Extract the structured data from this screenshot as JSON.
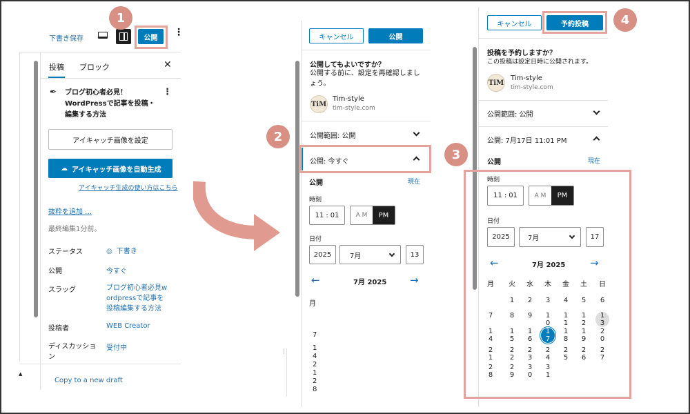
{
  "colors": {
    "accent": "#007cba",
    "badge": "#d88f84",
    "highlight": "#e3a59b",
    "arrow": "#e09a8f"
  },
  "step_badges": [
    "1",
    "2",
    "3",
    "4"
  ],
  "panel1": {
    "save_draft": "下書き保存",
    "publish": "公開",
    "tabs": {
      "post": "投稿",
      "block": "ブロック"
    },
    "post_title": "ブログ初心者必見！WordPressで記事を投稿・編集する方法",
    "set_featured": "アイキャッチ画像を設定",
    "auto_featured": "アイキャッチ画像を自動生成",
    "help_link": "アイキャッチ生成の使い方はこちら",
    "add_excerpt": "抜粋を追加 …",
    "last_edited": "最終編集1分前。",
    "rows": {
      "status_label": "ステータス",
      "status_value": "下書き",
      "publish_label": "公開",
      "publish_value": "今すぐ",
      "slug_label": "スラッグ",
      "slug_value": "ブログ初心者必見wordpressで記事を投稿編集する方法",
      "author_label": "投稿者",
      "author_value": "WEB Creator",
      "discussion_label": "ディスカッション",
      "discussion_value": "受付中"
    },
    "copy_draft": "Copy to a new draft"
  },
  "panel2": {
    "cancel": "キャンセル",
    "publish": "公開",
    "confirm_title": "公開してもよいですか？",
    "confirm_desc": "公開する前に、設定を再確認しましょう。",
    "site_name": "Tim-style",
    "site_url": "tim-style.com",
    "avatar_text": "TiM",
    "visibility": "公開範囲: 公開",
    "publish_row": "公開: 今すぐ",
    "publish_heading": "公開",
    "now": "現在",
    "time_label": "時刻",
    "hour": "11",
    "minute": "01",
    "am": "A M",
    "pm": "PM",
    "date_label": "日付",
    "year": "2025",
    "month": "7月",
    "day": "13",
    "cal_title": "7月 2025",
    "weekday_first": "月",
    "col_digits": [
      "7",
      "",
      "1",
      "4",
      "2",
      "1",
      "2",
      "8"
    ]
  },
  "panel3": {
    "cancel": "キャンセル",
    "schedule": "予約投稿",
    "confirm_title": "投稿を予約しますか？",
    "confirm_desc": "この投稿は設定日時に公開されます。",
    "site_name": "Tim-style",
    "site_url": "tim-style.com",
    "avatar_text": "TiM",
    "visibility": "公開範囲: 公開",
    "publish_row": "公開: 7月17日 11:01 PM",
    "publish_heading": "公開",
    "now": "現在",
    "time_label": "時刻",
    "hour": "11",
    "minute": "01",
    "am": "A M",
    "pm": "PM",
    "date_label": "日付",
    "year": "2025",
    "month": "7月",
    "day": "17",
    "cal_title": "7月 2025",
    "weekdays": [
      "月",
      "火",
      "水",
      "木",
      "金",
      "土",
      "日"
    ],
    "calendar_rows": [
      [
        "",
        "1",
        "2",
        "3",
        "4",
        "5",
        "6"
      ],
      [
        "7",
        "8",
        "9",
        "10",
        "11",
        "12",
        "13"
      ],
      [
        "14",
        "15",
        "16",
        "17",
        "18",
        "19",
        "20"
      ],
      [
        "21",
        "22",
        "23",
        "24",
        "25",
        "26",
        "27"
      ],
      [
        "28",
        "29",
        "30",
        "31",
        "",
        "",
        ""
      ]
    ],
    "selected_day": "17",
    "today_day": "13"
  }
}
